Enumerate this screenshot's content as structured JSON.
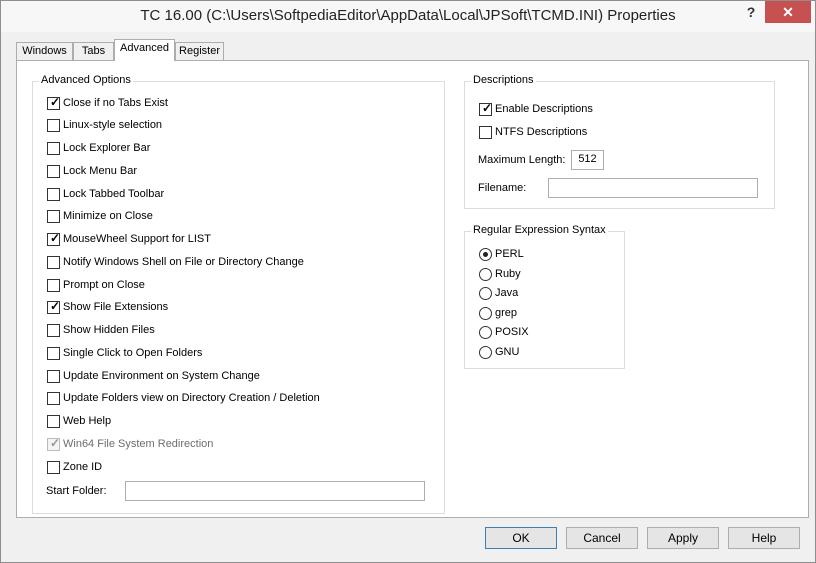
{
  "window": {
    "title": "TC 16.00  (C:\\Users\\SoftpediaEditor\\AppData\\Local\\JPSoft\\TCMD.INI)  Properties",
    "help_glyph": "?",
    "close_glyph": "✕"
  },
  "tabs": [
    {
      "label": "Windows"
    },
    {
      "label": "Tabs"
    },
    {
      "label": "Advanced",
      "active": true
    },
    {
      "label": "Register"
    }
  ],
  "advanced_options": {
    "legend": "Advanced Options",
    "items": [
      {
        "label": "Close if no Tabs Exist",
        "checked": true
      },
      {
        "label": "Linux-style selection",
        "checked": false
      },
      {
        "label": "Lock Explorer Bar",
        "checked": false
      },
      {
        "label": "Lock Menu Bar",
        "checked": false
      },
      {
        "label": "Lock Tabbed Toolbar",
        "checked": false
      },
      {
        "label": "Minimize on Close",
        "checked": false
      },
      {
        "label": "MouseWheel Support for LIST",
        "checked": true
      },
      {
        "label": "Notify Windows Shell on File or Directory Change",
        "checked": false
      },
      {
        "label": "Prompt on Close",
        "checked": false
      },
      {
        "label": "Show File Extensions",
        "checked": true
      },
      {
        "label": "Show Hidden Files",
        "checked": false
      },
      {
        "label": "Single Click to Open Folders",
        "checked": false
      },
      {
        "label": "Update Environment on System Change",
        "checked": false
      },
      {
        "label": "Update Folders view on Directory Creation / Deletion",
        "checked": false
      },
      {
        "label": "Web Help",
        "checked": false
      },
      {
        "label": "Win64 File System Redirection",
        "checked": true,
        "disabled": true
      },
      {
        "label": "Zone ID",
        "checked": false
      }
    ],
    "start_folder_label": "Start Folder:",
    "start_folder_value": ""
  },
  "descriptions": {
    "legend": "Descriptions",
    "enable_label": "Enable Descriptions",
    "enable_checked": true,
    "ntfs_label": "NTFS Descriptions",
    "ntfs_checked": false,
    "max_length_label": "Maximum Length:",
    "max_length_value": "512",
    "filename_label": "Filename:",
    "filename_value": ""
  },
  "regex": {
    "legend": "Regular Expression Syntax",
    "options": [
      {
        "label": "PERL",
        "selected": true
      },
      {
        "label": "Ruby",
        "selected": false
      },
      {
        "label": "Java",
        "selected": false
      },
      {
        "label": "grep",
        "selected": false
      },
      {
        "label": "POSIX",
        "selected": false
      },
      {
        "label": "GNU",
        "selected": false
      }
    ]
  },
  "buttons": {
    "ok": "OK",
    "cancel": "Cancel",
    "apply": "Apply",
    "help": "Help"
  },
  "checkmark_glyph": "✓"
}
